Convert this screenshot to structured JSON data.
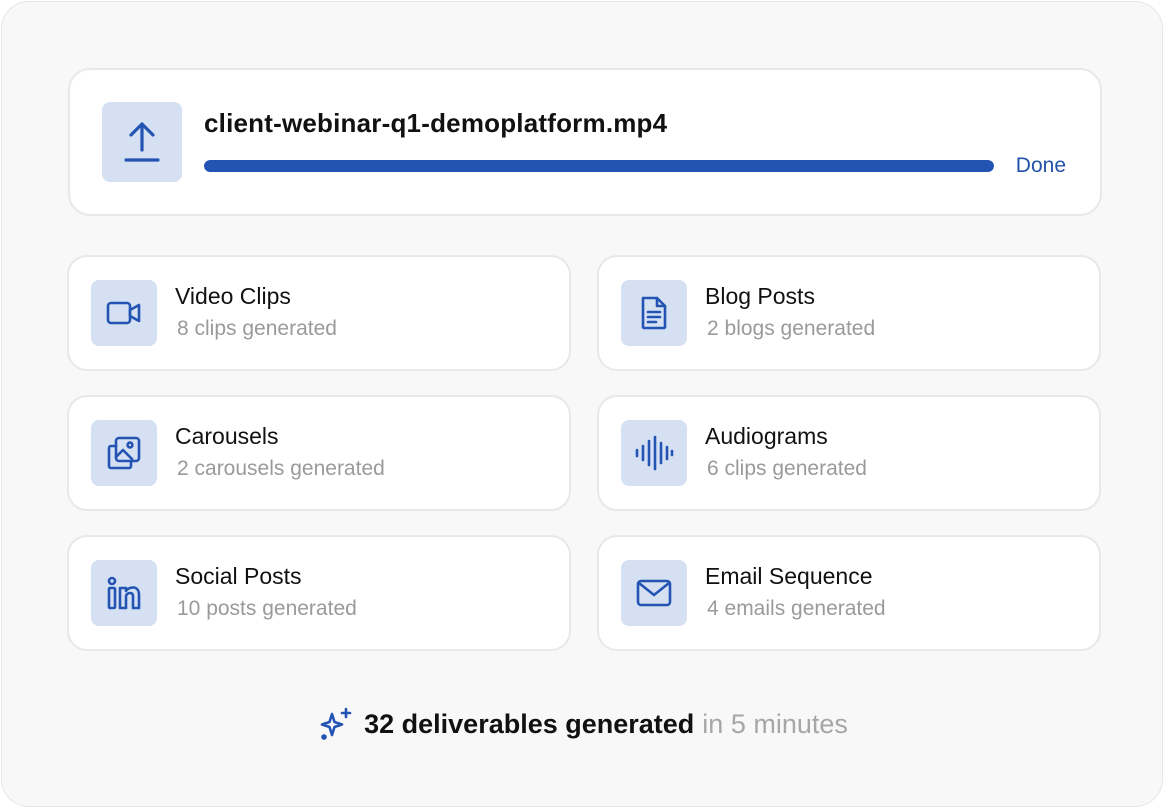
{
  "upload": {
    "file_name": "client-webinar-q1-demoplatform.mp4",
    "status": "Done",
    "progress_percent": 100,
    "icon": "upload-icon"
  },
  "deliverables": [
    {
      "title": "Video Clips",
      "subtitle": "8 clips generated",
      "icon": "video-camera-icon"
    },
    {
      "title": "Blog Posts",
      "subtitle": "2 blogs generated",
      "icon": "document-icon"
    },
    {
      "title": "Carousels",
      "subtitle": "2 carousels generated",
      "icon": "image-gallery-icon"
    },
    {
      "title": "Audiograms",
      "subtitle": "6 clips generated",
      "icon": "audio-waveform-icon"
    },
    {
      "title": "Social Posts",
      "subtitle": "10 posts generated",
      "icon": "linkedin-icon"
    },
    {
      "title": "Email Sequence",
      "subtitle": "4 emails generated",
      "icon": "mail-icon"
    }
  ],
  "summary": {
    "highlight": "32 deliverables generated",
    "suffix": "in 5 minutes",
    "icon": "sparkles-icon"
  },
  "colors": {
    "accent": "#2354b4",
    "icon_bg": "#d5e0f2",
    "muted_text": "#9a9a9a"
  }
}
